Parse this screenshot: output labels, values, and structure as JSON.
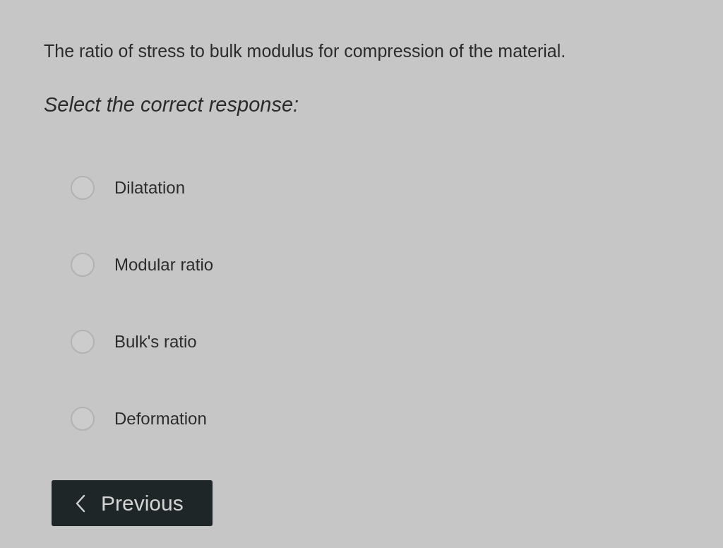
{
  "question": {
    "text": "The ratio of stress to bulk modulus for compression of the material."
  },
  "instruction": "Select the correct response:",
  "options": [
    {
      "label": "Dilatation",
      "selected": false
    },
    {
      "label": "Modular ratio",
      "selected": false
    },
    {
      "label": "Bulk's ratio",
      "selected": false
    },
    {
      "label": "Deformation",
      "selected": false
    }
  ],
  "buttons": [
    {
      "kind": "previous",
      "label": "Previous"
    }
  ]
}
